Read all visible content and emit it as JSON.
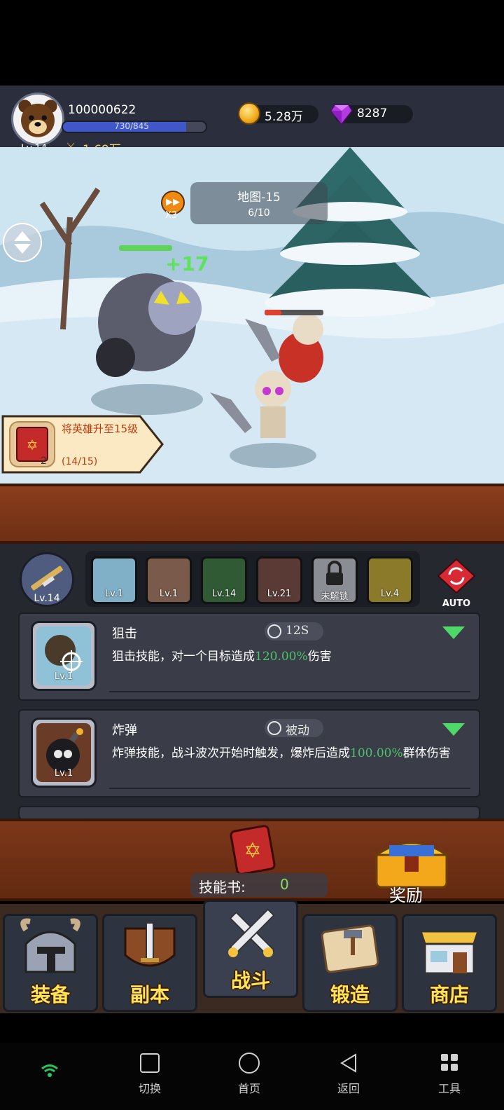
{
  "player": {
    "level": "Lv.14",
    "id": "100000622",
    "xp_text": "730/845",
    "xp_fraction": 0.864,
    "power": "1.69万"
  },
  "currency": {
    "coins": "5.28万",
    "gems": "8287"
  },
  "battle": {
    "map_name": "地图-15",
    "wave": "6/10",
    "speed": "X3",
    "damage_popup": "+17"
  },
  "quest": {
    "title": "将英雄升至15级",
    "progress": "(14/15)",
    "reward_count": "2"
  },
  "weapon": {
    "level": "Lv.14"
  },
  "skill_slots": [
    {
      "level": "Lv.1",
      "color": "#7fb0c8"
    },
    {
      "level": "Lv.1",
      "color": "#7a5a4a"
    },
    {
      "level": "Lv.14",
      "color": "#2f5a33"
    },
    {
      "level": "Lv.21",
      "color": "#5a3a35"
    },
    {
      "level": "未解锁",
      "color": "#8b8d94"
    },
    {
      "level": "Lv.4",
      "color": "#8a7a2a"
    }
  ],
  "auto_label": "AUTO",
  "skills": [
    {
      "name": "狙击",
      "tag": "12S",
      "level": "Lv.1",
      "desc_pre": "狙击技能，对一个目标造成",
      "desc_value": "120.00%",
      "desc_post": "伤害"
    },
    {
      "name": "炸弹",
      "tag": "被动",
      "level": "Lv.1",
      "desc_pre": "炸弹技能，战斗波次开始时触发，爆炸后造成",
      "desc_value": "100.00%",
      "desc_post": "群体伤害"
    }
  ],
  "skill_book": {
    "label": "技能书:",
    "count": "0"
  },
  "reward_label": "奖励",
  "tabs": [
    "装备",
    "副本",
    "战斗",
    "锻造",
    "商店"
  ],
  "system_nav": [
    "切换",
    "首页",
    "返回",
    "工具"
  ]
}
